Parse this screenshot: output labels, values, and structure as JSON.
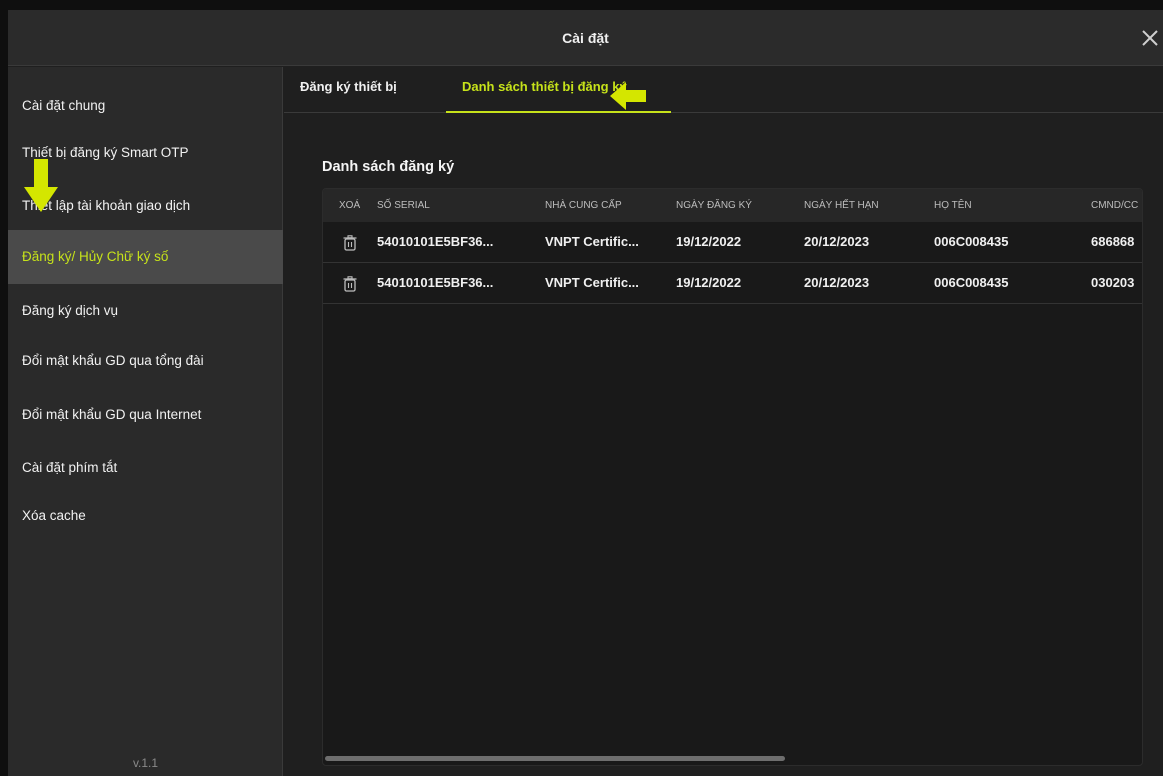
{
  "window": {
    "title": "Cài đặt",
    "close_icon": "close-icon"
  },
  "sidebar": {
    "items": [
      {
        "label": "Cài đặt chung"
      },
      {
        "label": "Thiết bị đăng ký Smart OTP"
      },
      {
        "label": "Thiết lập tài khoản giao dịch"
      },
      {
        "label": "Đăng ký/ Hủy Chữ ký số",
        "active": true
      },
      {
        "label": "Đăng ký dịch vụ"
      },
      {
        "label": "Đổi mật khẩu GD qua tổng đài"
      },
      {
        "label": "Đổi mật khẩu GD qua Internet"
      },
      {
        "label": "Cài đặt phím tắt"
      },
      {
        "label": "Xóa cache"
      }
    ],
    "version": "v.1.1"
  },
  "tabs": [
    {
      "label": "Đăng ký thiết bị"
    },
    {
      "label": "Danh sách thiết bị đăng ký",
      "active": true
    }
  ],
  "section_title": "Danh sách đăng ký",
  "table": {
    "columns": [
      "XOÁ",
      "SỐ SERIAL",
      "NHÀ CUNG CẤP",
      "NGÀY ĐĂNG KÝ",
      "NGÀY HẾT HẠN",
      "HỌ TÊN",
      "CMND/CC"
    ],
    "rows": [
      {
        "serial": "54010101E5BF36...",
        "provider": "VNPT Certific...",
        "reg_date": "19/12/2022",
        "exp_date": "20/12/2023",
        "name": "006C008435",
        "id": "686868"
      },
      {
        "serial": "54010101E5BF36...",
        "provider": "VNPT Certific...",
        "reg_date": "19/12/2022",
        "exp_date": "20/12/2023",
        "name": "006C008435",
        "id": "030203"
      }
    ],
    "delete_icon": "trash-icon"
  },
  "colors": {
    "accent": "#c6e21a",
    "annotation_arrow": "#d4e600",
    "background": "#1f1f1f",
    "sidebar_bg": "#2a2a2a",
    "active_item_bg": "#4a4a4a"
  }
}
